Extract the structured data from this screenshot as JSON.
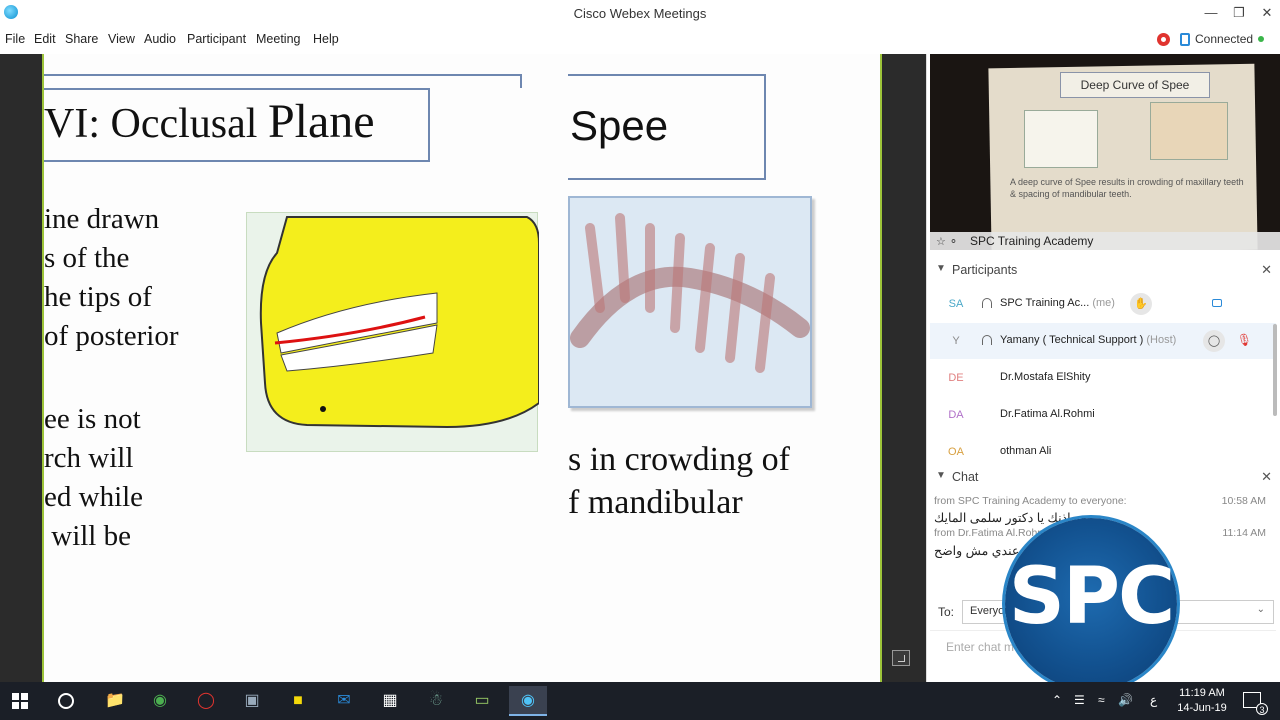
{
  "window": {
    "title": "Cisco Webex Meetings"
  },
  "menu": [
    "File",
    "Edit",
    "Share",
    "View",
    "Audio",
    "Participant",
    "Meeting",
    "Help"
  ],
  "status": {
    "connection": "Connected"
  },
  "slide": {
    "title_left_prefix": "VI: Occlusal ",
    "title_left_big": "Plane",
    "title_right": "Spee",
    "body_left_1": "ine drawn\ns of the\nhe tips of\nof posterior",
    "body_left_2": "ee is not\nrch will\ned while\n will be",
    "body_right": "s in crowding of\nf mandibular"
  },
  "video": {
    "name": "SPC Training Academy",
    "slide_title": "Deep Curve of Spee",
    "slide_text": "A deep curve of Spee results in crowding of maxillary teeth & spacing of mandibular teeth."
  },
  "participants": {
    "header": "Participants",
    "list": [
      {
        "initials": "SA",
        "name": "SPC Training Ac...",
        "role": "(me)",
        "initials_color": "#4aa8c8"
      },
      {
        "initials": "Y",
        "name": "Yamany ( Technical Support )",
        "role": "(Host)",
        "initials_color": "#888888"
      },
      {
        "initials": "DE",
        "name": "Dr.Mostafa ElShity",
        "role": "",
        "initials_color": "#e08080"
      },
      {
        "initials": "DA",
        "name": "Dr.Fatima Al.Rohmi",
        "role": "",
        "initials_color": "#b070c8"
      },
      {
        "initials": "OA",
        "name": "othman Ali",
        "role": "",
        "initials_color": "#d8a040"
      }
    ]
  },
  "chat": {
    "header": "Chat",
    "messages": [
      {
        "meta": "from SPC Training Academy to everyone:",
        "time": "10:58 AM",
        "text": "بعد اذنك يا دكتور سلمى المايك"
      },
      {
        "meta": "from Dr.Fatima Al.Rohmi to everyone:",
        "time": "11:14 AM",
        "text": "الصوت عندي مش واضح"
      }
    ],
    "to_label": "To:",
    "to_value": "Everyone",
    "input_placeholder": "Enter chat message here"
  },
  "logo": {
    "text": "SPC"
  },
  "taskbar": {
    "time": "11:19 AM",
    "date": "14-Jun-19",
    "lang": "ع",
    "notifications": "3"
  }
}
